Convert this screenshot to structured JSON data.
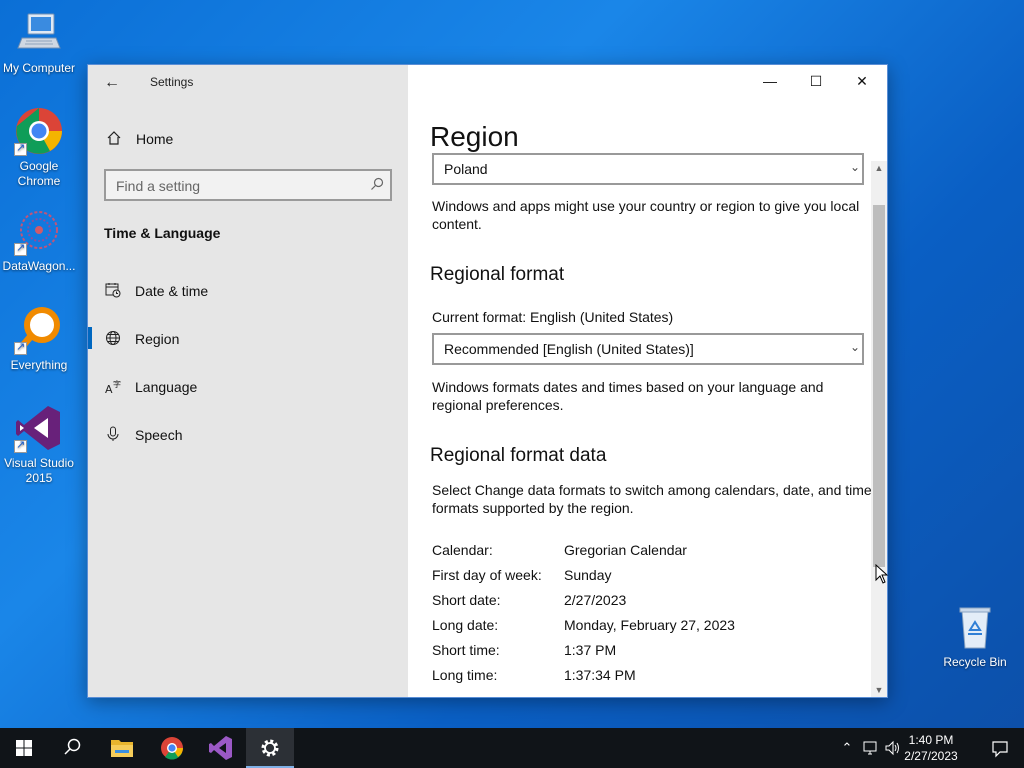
{
  "desktop": {
    "icons": [
      {
        "label": "My Computer",
        "icon": "computer-icon"
      },
      {
        "label": "Google Chrome",
        "icon": "chrome-icon"
      },
      {
        "label": "DataWagon...",
        "icon": "datawagon-icon"
      },
      {
        "label": "Everything",
        "icon": "everything-icon"
      },
      {
        "label": "Visual Studio 2015",
        "icon": "visual-studio-icon"
      },
      {
        "label": "Recycle Bin",
        "icon": "recycle-bin-icon"
      }
    ]
  },
  "window": {
    "app_title": "Settings",
    "caption": {
      "minimize": "—",
      "maximize": "☐",
      "close": "✕"
    },
    "sidebar": {
      "home_label": "Home",
      "search_placeholder": "Find a setting",
      "section_title": "Time & Language",
      "items": [
        {
          "label": "Date & time",
          "icon": "calendar-clock-icon"
        },
        {
          "label": "Region",
          "icon": "globe-icon",
          "active": true
        },
        {
          "label": "Language",
          "icon": "language-icon"
        },
        {
          "label": "Speech",
          "icon": "microphone-icon"
        }
      ]
    },
    "content": {
      "page_title": "Region",
      "country_value": "Poland",
      "country_desc": "Windows and apps might use your country or region to give you local content.",
      "regional_format_heading": "Regional format",
      "current_format": "Current format: English (United States)",
      "format_value": "Recommended [English (United States)]",
      "format_desc": "Windows formats dates and times based on your language and regional preferences.",
      "format_data_heading": "Regional format data",
      "format_data_desc": "Select Change data formats to switch among calendars, date, and time formats supported by the region.",
      "format_data_rows": [
        {
          "key": "Calendar:",
          "value": "Gregorian Calendar"
        },
        {
          "key": "First day of week:",
          "value": "Sunday"
        },
        {
          "key": "Short date:",
          "value": "2/27/2023"
        },
        {
          "key": "Long date:",
          "value": "Monday, February 27, 2023"
        },
        {
          "key": "Short time:",
          "value": "1:37 PM"
        },
        {
          "key": "Long time:",
          "value": "1:37:34 PM"
        }
      ]
    }
  },
  "taskbar": {
    "time": "1:40 PM",
    "date": "2/27/2023",
    "apps": [
      "start-icon",
      "search-icon",
      "file-explorer-icon",
      "chrome-icon",
      "visual-studio-icon",
      "settings-gear-icon"
    ]
  },
  "colors": {
    "accent": "#0067c0",
    "desktop": "#1a86e8",
    "taskbar": "#101418"
  }
}
